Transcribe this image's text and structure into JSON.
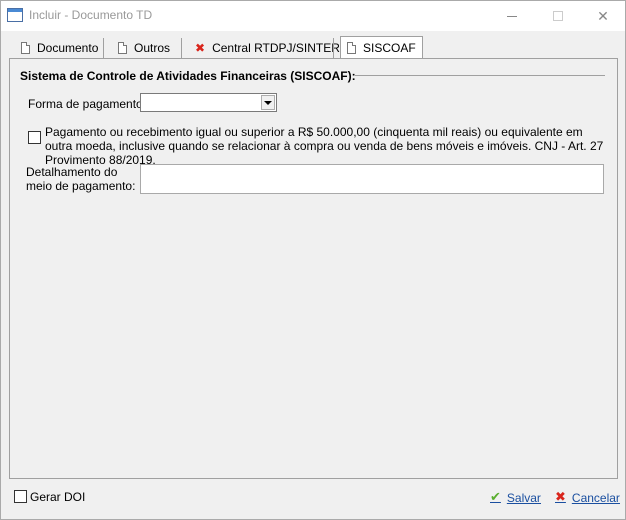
{
  "window": {
    "title": "Incluir - Documento TD",
    "icon": "window-icon"
  },
  "tabs": [
    {
      "label": "Documento",
      "icon": "document-icon",
      "active": false
    },
    {
      "label": "Outros",
      "icon": "document-icon",
      "active": false
    },
    {
      "label": "Central RTDPJ/SINTER",
      "icon": "error-x-icon",
      "active": false
    },
    {
      "label": "SISCOAF",
      "icon": "document-icon",
      "active": true
    }
  ],
  "section": {
    "title": "Sistema de Controle de Atividades Financeiras (SISCOAF):"
  },
  "form": {
    "payment_method_label": "Forma de pagamento:",
    "payment_method_value": "",
    "threshold_checkbox_checked": false,
    "threshold_checkbox_text": "Pagamento ou recebimento igual ou superior a R$ 50.000,00 (cinquenta mil reais) ou equivalente em outra moeda, inclusive quando se relacionar à compra ou venda de bens móveis e imóveis. CNJ - Art. 27 Provimento 88/2019.",
    "detail_label_line1": "Detalhamento do",
    "detail_label_line2": "meio de pagamento:",
    "detail_value": ""
  },
  "footer": {
    "generate_doi_label": "Gerar DOI",
    "generate_doi_checked": false,
    "save_label": "Salvar",
    "cancel_label": "Cancelar"
  },
  "colors": {
    "error_icon": "#d9251c",
    "save_icon": "#5aae2e",
    "link_text": "#1a4fa0"
  }
}
